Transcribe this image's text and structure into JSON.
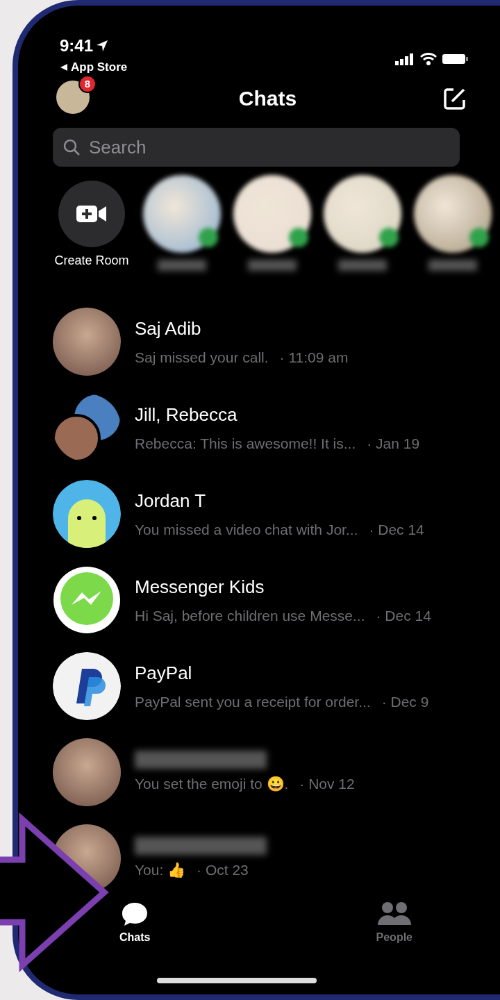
{
  "status_bar": {
    "time": "9:41",
    "back_label": "App Store"
  },
  "header": {
    "badge": "8",
    "title": "Chats"
  },
  "search": {
    "placeholder": "Search"
  },
  "stories": [
    {
      "kind": "create",
      "label": "Create Room"
    },
    {
      "kind": "contact",
      "online": true
    },
    {
      "kind": "contact",
      "online": true
    },
    {
      "kind": "contact",
      "online": true
    },
    {
      "kind": "contact",
      "online": true
    }
  ],
  "chats": [
    {
      "kind": "photo",
      "name": "Saj Adib",
      "preview": "Saj missed your call.",
      "time": "· 11:09 am"
    },
    {
      "kind": "group",
      "name": "Jill, Rebecca",
      "preview": "Rebecca: This is awesome!!  It is...",
      "time": "· Jan 19"
    },
    {
      "kind": "cartoon",
      "name": "Jordan T",
      "preview": "You missed a video chat with Jor...",
      "time": "· Dec 14"
    },
    {
      "kind": "messenger-kids",
      "name": "Messenger Kids",
      "preview": "Hi Saj, before children use Messe...",
      "time": "· Dec 14"
    },
    {
      "kind": "paypal",
      "name": "PayPal",
      "preview": "PayPal sent you a receipt for order...",
      "time": "· Dec 9"
    },
    {
      "kind": "photo",
      "preview": "You set the emoji to 😀.",
      "time": "· Nov 12"
    },
    {
      "kind": "photo",
      "preview": "You: 👍",
      "time": "· Oct 23"
    }
  ],
  "tabs": [
    {
      "label": "Chats",
      "selected": true
    },
    {
      "label": "People",
      "selected": false
    }
  ]
}
